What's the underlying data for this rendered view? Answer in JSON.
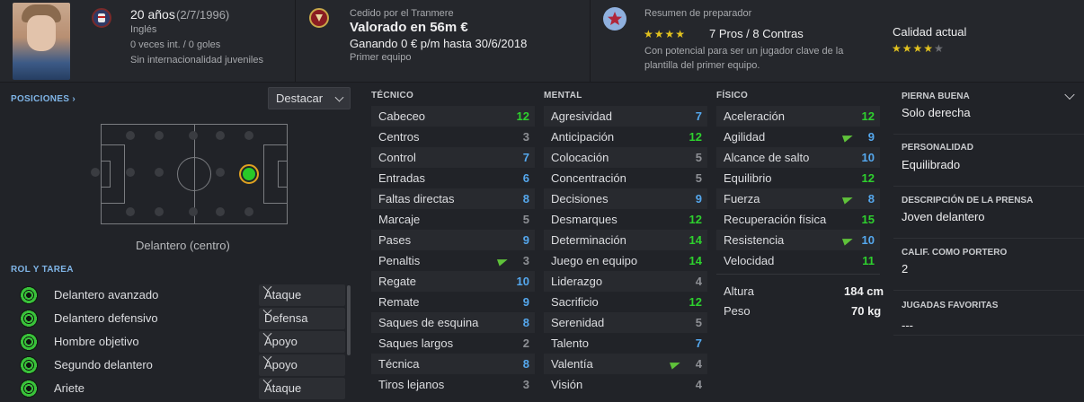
{
  "header": {
    "age": "20 años",
    "dob": "(2/7/1996)",
    "nationality": "Inglés",
    "caps": "0 veces int. / 0 goles",
    "youth": "Sin internacionalidad juveniles",
    "loan_from": "Cedido por el Tranmere",
    "value": "Valorado en 56m €",
    "wage": "Ganando 0 € p/m hasta 30/6/2018",
    "squad": "Primer equipo",
    "coach_title": "Resumen de preparador",
    "pros_cons": "7 Pros / 8 Contras",
    "coach_text_1": "Con potencial para ser un jugador clave de la",
    "coach_text_2": "plantilla del primer equipo.",
    "current_ability_label": "Calidad actual",
    "coach_stars": 4,
    "current_stars": 4,
    "current_stars_total": 5
  },
  "positions": {
    "title": "POSICIONES",
    "highlight_button": "Destacar",
    "position_label": "Delantero (centro)"
  },
  "roles": {
    "title": "ROL Y TAREA",
    "items": [
      {
        "name": "Delantero avanzado",
        "duty": "Ataque"
      },
      {
        "name": "Delantero defensivo",
        "duty": "Defensa"
      },
      {
        "name": "Hombre objetivo",
        "duty": "Apoyo"
      },
      {
        "name": "Segundo delantero",
        "duty": "Apoyo"
      },
      {
        "name": "Ariete",
        "duty": "Ataque"
      }
    ]
  },
  "technical": {
    "title": "TÉCNICO",
    "attrs": [
      {
        "name": "Cabeceo",
        "value": "12",
        "color": "green"
      },
      {
        "name": "Centros",
        "value": "3",
        "color": "grey"
      },
      {
        "name": "Control",
        "value": "7",
        "color": "blue"
      },
      {
        "name": "Entradas",
        "value": "6",
        "color": "blue"
      },
      {
        "name": "Faltas directas",
        "value": "8",
        "color": "blue"
      },
      {
        "name": "Marcaje",
        "value": "5",
        "color": "grey"
      },
      {
        "name": "Pases",
        "value": "9",
        "color": "blue"
      },
      {
        "name": "Penaltis",
        "value": "3",
        "color": "grey",
        "arrow": true
      },
      {
        "name": "Regate",
        "value": "10",
        "color": "blue"
      },
      {
        "name": "Remate",
        "value": "9",
        "color": "blue"
      },
      {
        "name": "Saques de esquina",
        "value": "8",
        "color": "blue"
      },
      {
        "name": "Saques largos",
        "value": "2",
        "color": "grey"
      },
      {
        "name": "Técnica",
        "value": "8",
        "color": "blue"
      },
      {
        "name": "Tiros lejanos",
        "value": "3",
        "color": "grey"
      }
    ]
  },
  "mental": {
    "title": "MENTAL",
    "attrs": [
      {
        "name": "Agresividad",
        "value": "7",
        "color": "blue"
      },
      {
        "name": "Anticipación",
        "value": "12",
        "color": "green"
      },
      {
        "name": "Colocación",
        "value": "5",
        "color": "grey"
      },
      {
        "name": "Concentración",
        "value": "5",
        "color": "grey"
      },
      {
        "name": "Decisiones",
        "value": "9",
        "color": "blue"
      },
      {
        "name": "Desmarques",
        "value": "12",
        "color": "green"
      },
      {
        "name": "Determinación",
        "value": "14",
        "color": "green"
      },
      {
        "name": "Juego en equipo",
        "value": "14",
        "color": "green"
      },
      {
        "name": "Liderazgo",
        "value": "4",
        "color": "grey"
      },
      {
        "name": "Sacrificio",
        "value": "12",
        "color": "green"
      },
      {
        "name": "Serenidad",
        "value": "5",
        "color": "grey"
      },
      {
        "name": "Talento",
        "value": "7",
        "color": "blue"
      },
      {
        "name": "Valentía",
        "value": "4",
        "color": "grey",
        "arrow": true
      },
      {
        "name": "Visión",
        "value": "4",
        "color": "grey"
      }
    ]
  },
  "physical": {
    "title": "FÍSICO",
    "attrs": [
      {
        "name": "Aceleración",
        "value": "12",
        "color": "green"
      },
      {
        "name": "Agilidad",
        "value": "9",
        "color": "blue",
        "arrow": true
      },
      {
        "name": "Alcance de salto",
        "value": "10",
        "color": "blue"
      },
      {
        "name": "Equilibrio",
        "value": "12",
        "color": "green"
      },
      {
        "name": "Fuerza",
        "value": "8",
        "color": "blue",
        "arrow": true
      },
      {
        "name": "Recuperación física",
        "value": "15",
        "color": "green"
      },
      {
        "name": "Resistencia",
        "value": "10",
        "color": "blue",
        "arrow": true
      },
      {
        "name": "Velocidad",
        "value": "11",
        "color": "green"
      }
    ],
    "height_label": "Altura",
    "height_value": "184 cm",
    "weight_label": "Peso",
    "weight_value": "70 kg"
  },
  "info": {
    "foot_label": "PIERNA BUENA",
    "foot_value": "Solo derecha",
    "personality_label": "PERSONALIDAD",
    "personality_value": "Equilibrado",
    "press_label": "DESCRIPCIÓN DE LA PRENSA",
    "press_value": "Joven delantero",
    "gk_label": "CALIF. COMO PORTERO",
    "gk_value": "2",
    "plays_label": "JUGADAS FAVORITAS",
    "plays_value": "---"
  },
  "colors": {
    "green": "#2ed02e",
    "blue": "#55a8ee",
    "grey": "#8e9095",
    "star": "#e2c21f"
  }
}
